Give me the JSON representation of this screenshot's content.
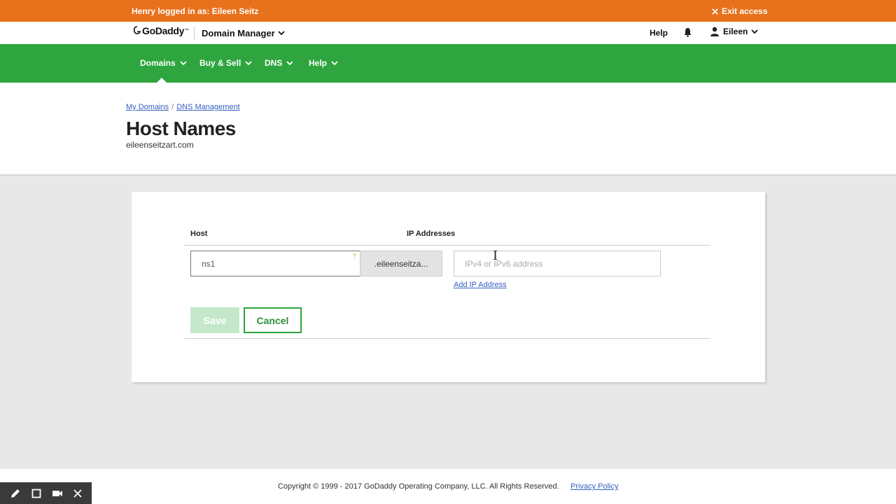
{
  "impersonation": {
    "message": "Henry logged in as: Eileen Seitz",
    "exit_label": "Exit access"
  },
  "brand": {
    "logo": "GoDaddy",
    "logo_mark": "™",
    "product": "Domain Manager",
    "help": "Help",
    "user": "Eileen"
  },
  "nav": {
    "items": [
      {
        "label": "Domains"
      },
      {
        "label": "Buy & Sell"
      },
      {
        "label": "DNS"
      },
      {
        "label": "Help"
      }
    ]
  },
  "breadcrumb": {
    "items": [
      "My Domains",
      "DNS Management"
    ],
    "separator": "/"
  },
  "page": {
    "title": "Host Names",
    "domain": "eileenseitzart.com"
  },
  "form": {
    "host_header": "Host",
    "ip_header": "IP Addresses",
    "host_value": "ns1",
    "domain_suffix": ".eileenseitza...",
    "ip_placeholder": "IPv4 or IPv6 address",
    "add_ip": "Add IP Address",
    "save": "Save",
    "cancel": "Cancel"
  },
  "footer": {
    "copyright": "Copyright © 1999 - 2017 GoDaddy Operating Company, LLC. All Rights Reserved.",
    "privacy": "Privacy Policy"
  },
  "recorder": {
    "tools": [
      "pen-icon",
      "square-icon",
      "camera-icon",
      "close-icon"
    ]
  },
  "colors": {
    "impersonation_bar": "#e8711c",
    "nav_bar": "#2ea53e",
    "link": "#3560c0",
    "save_disabled": "#c5e8cb"
  }
}
